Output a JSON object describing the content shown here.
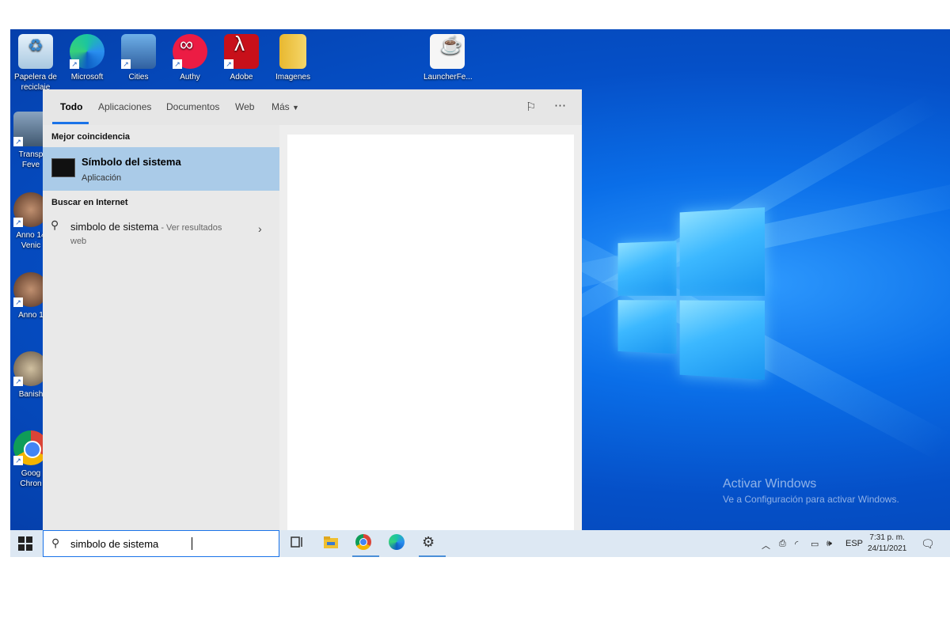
{
  "desktop": {
    "icons": [
      {
        "label": "Papelera de\nreciclaje",
        "name": "recycle-bin-icon"
      },
      {
        "label": "Microsoft",
        "name": "edge-icon"
      },
      {
        "label": "Cities",
        "name": "cities-icon"
      },
      {
        "label": "Authy",
        "name": "authy-icon"
      },
      {
        "label": "Adobe",
        "name": "adobe-icon"
      },
      {
        "label": "Imagenes",
        "name": "folder-icon"
      },
      {
        "label": "LauncherFe...",
        "name": "java-icon"
      },
      {
        "label": "Transp\nFeve",
        "name": "transport-fever-icon"
      },
      {
        "label": "Anno 14\nVenic",
        "name": "anno-venice-icon"
      },
      {
        "label": "Anno 1",
        "name": "anno-icon"
      },
      {
        "label": "Banish",
        "name": "banished-icon"
      },
      {
        "label": "Goog\nChron",
        "name": "chrome-icon"
      }
    ],
    "watermark": {
      "title": "Activar Windows",
      "subtitle": "Ve a Configuración para activar Windows."
    }
  },
  "start_panel": {
    "tabs": [
      "Todo",
      "Aplicaciones",
      "Documentos",
      "Web",
      "Más"
    ],
    "best_match_title": "Mejor coincidencia",
    "best_match": {
      "name": "Símbolo del sistema",
      "type": "Aplicación"
    },
    "web_title": "Buscar en Internet",
    "web_result": {
      "query": "simbolo de sistema",
      "more": " - Ver resultados",
      "second_line": "web"
    }
  },
  "taskbar": {
    "search_value": "simbolo de sistema",
    "lang": "ESP",
    "time": "7:31 p. m.",
    "date": "24/11/2021"
  }
}
